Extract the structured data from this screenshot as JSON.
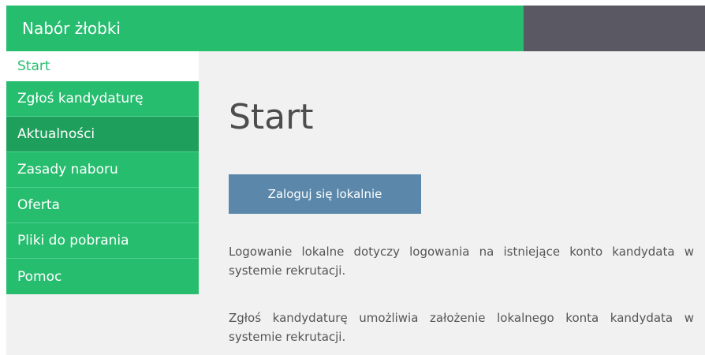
{
  "header": {
    "title": "Nabór żłobki"
  },
  "sidebar": {
    "items": [
      {
        "label": "Start"
      },
      {
        "label": "Zgłoś kandydaturę"
      },
      {
        "label": "Aktualności"
      },
      {
        "label": "Zasady naboru"
      },
      {
        "label": "Oferta"
      },
      {
        "label": "Pliki do pobrania"
      },
      {
        "label": "Pomoc"
      }
    ]
  },
  "main": {
    "title": "Start",
    "login_button": "Zaloguj się lokalnie",
    "paragraphs": [
      "Logowanie lokalne dotyczy logowania na istniejące konto kandydata w systemie rekrutacji.",
      "Zgłoś kandydaturę umożliwia założenie lokalnego konta kandydata w systemie rekrutacji."
    ]
  },
  "colors": {
    "brand_green": "#27bd6f",
    "dark_header": "#5a5863",
    "button_blue": "#5b88aa"
  }
}
